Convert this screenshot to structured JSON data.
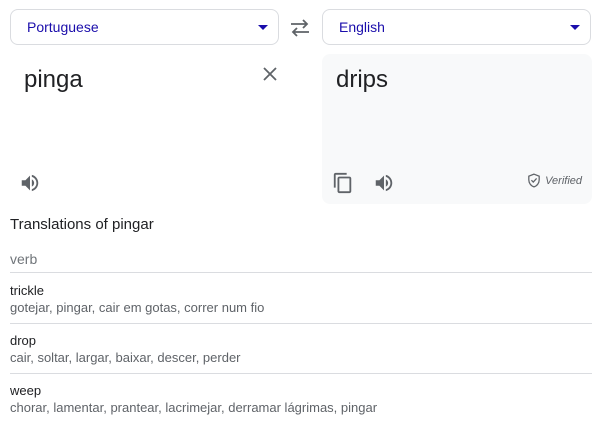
{
  "source_language": "Portuguese",
  "target_language": "English",
  "source_text": "pinga",
  "translated_text": "drips",
  "verified_label": "Verified",
  "translations_heading": "Translations of pingar",
  "part_of_speech": "verb",
  "entries": [
    {
      "word": "trickle",
      "synonyms": "gotejar, pingar, cair em gotas, correr num fio"
    },
    {
      "word": "drop",
      "synonyms": "cair, soltar, largar, baixar, descer, perder"
    },
    {
      "word": "weep",
      "synonyms": "chorar, lamentar, prantear, lacrimejar, derramar lágrimas, pingar"
    }
  ],
  "icons": {
    "swap": "swap-arrows-icon",
    "clear": "close-icon",
    "speak": "speaker-icon",
    "copy": "copy-icon",
    "verified": "shield-check-icon"
  },
  "colors": {
    "accent": "#1a0dab",
    "icon": "#5f6368",
    "panel_bg": "#f8f9fa",
    "divider": "#dadce0"
  }
}
